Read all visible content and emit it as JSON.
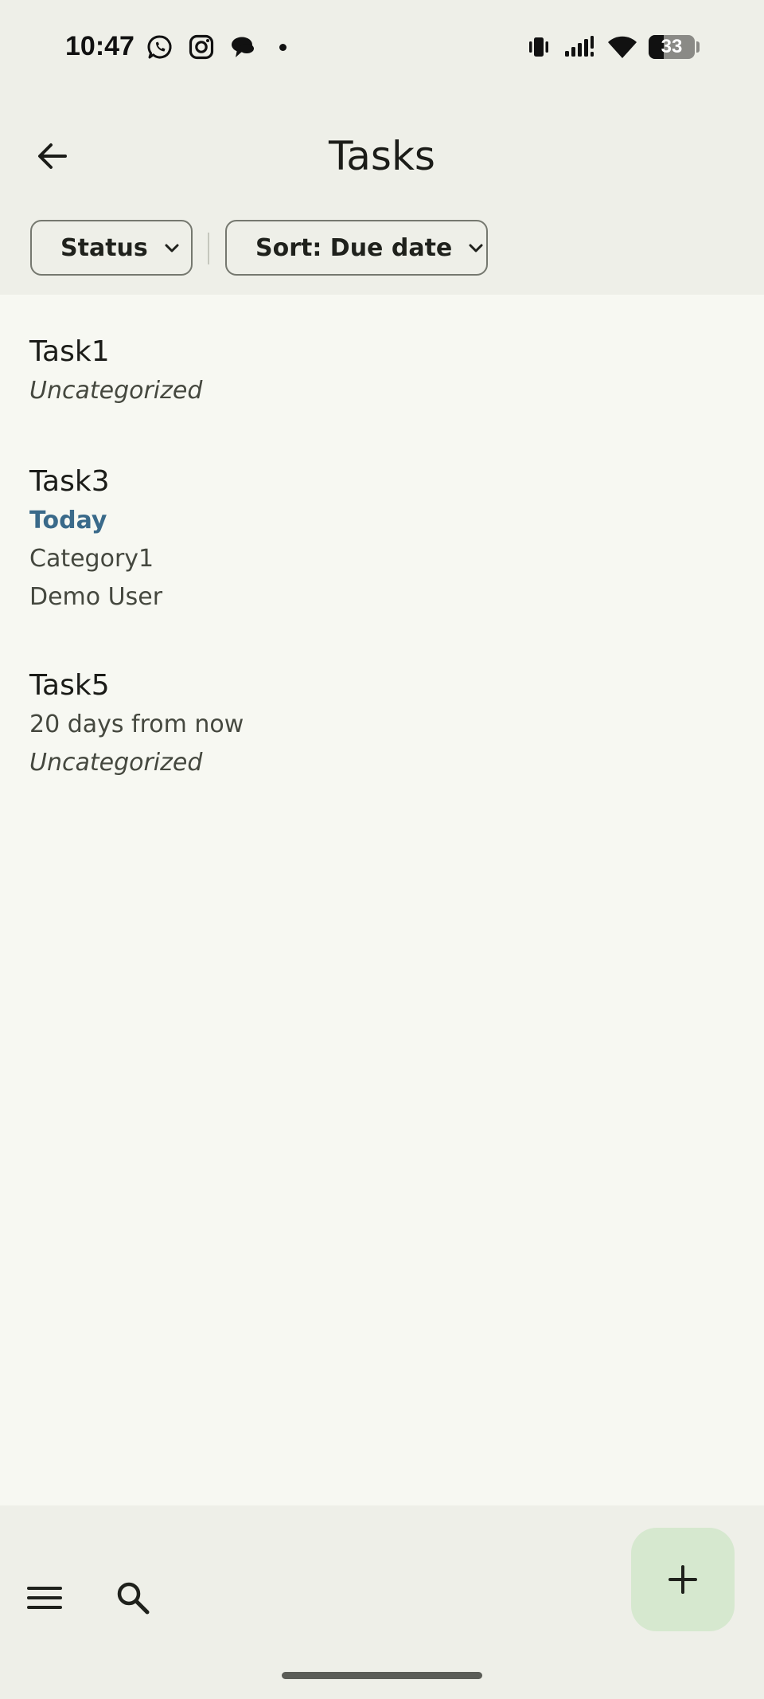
{
  "status_bar": {
    "time": "10:47",
    "battery_text": "33",
    "battery_level": 0.33,
    "left_icons": [
      "whatsapp-icon",
      "instagram-icon",
      "chat-bubble-icon",
      "notification-dot"
    ],
    "right_icons": [
      "vibrate-icon",
      "signal-icon",
      "wifi-icon",
      "battery-icon"
    ]
  },
  "header": {
    "title": "Tasks",
    "back_icon": "arrow-left-icon"
  },
  "filters": {
    "status_label": "Status",
    "sort_label": "Sort: Due date",
    "chevron_icon": "chevron-down-icon"
  },
  "tasks": [
    {
      "title": "Task1",
      "lines": [
        {
          "text": "Uncategorized",
          "style": "italic"
        }
      ]
    },
    {
      "title": "Task3",
      "lines": [
        {
          "text": "Today",
          "style": "today"
        },
        {
          "text": "Category1",
          "style": "normal"
        },
        {
          "text": "Demo User",
          "style": "normal"
        }
      ]
    },
    {
      "title": "Task5",
      "lines": [
        {
          "text": "20 days from now",
          "style": "normal"
        },
        {
          "text": "Uncategorized",
          "style": "italic"
        }
      ]
    }
  ],
  "bottom_bar": {
    "menu_icon": "hamburger-menu-icon",
    "search_icon": "search-icon",
    "fab_icon": "plus-icon"
  },
  "colors": {
    "background": "#f7f8f2",
    "bars": "#eeefe8",
    "today_accent": "#3a6a8a",
    "fab": "#d6e8cf"
  }
}
